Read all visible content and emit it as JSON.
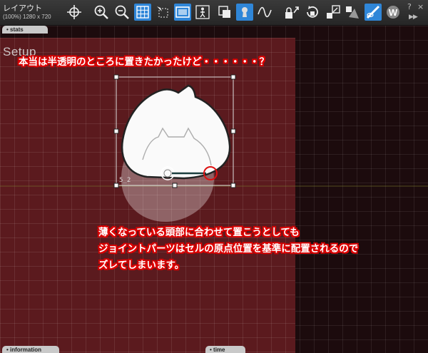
{
  "window": {
    "title": "レイアウト",
    "subtitle": "(100%) 1280 x 720",
    "help": "?",
    "close": "×",
    "expand": "▶▶"
  },
  "toolbar": {
    "active_color": "#2f86d8",
    "icons": [
      {
        "name": "crosshair-icon",
        "active": false
      },
      {
        "name": "zoom-in-icon",
        "active": false
      },
      {
        "name": "zoom-out-icon",
        "active": false
      },
      {
        "name": "grid-icon",
        "active": true
      },
      {
        "name": "select-region-icon",
        "active": false
      },
      {
        "name": "frame-icon",
        "active": true
      },
      {
        "name": "person-icon",
        "active": false
      },
      {
        "name": "layer-stack-icon",
        "active": false
      },
      {
        "name": "keyhole-icon",
        "active": true
      },
      {
        "name": "curve-icon",
        "active": false
      },
      {
        "name": "lock-arrow-icon",
        "active": false
      },
      {
        "name": "rotate-lock-icon",
        "active": false
      },
      {
        "name": "scale-lock-icon",
        "active": false
      },
      {
        "name": "skew-icon",
        "active": false
      },
      {
        "name": "eye-knife-icon",
        "active": true
      },
      {
        "name": "weight-icon",
        "active": false
      }
    ]
  },
  "panels": {
    "stats": "• stats",
    "information": "• information",
    "time": "• time"
  },
  "stage": {
    "label": "Setup",
    "stage_color": "#5b1a1e",
    "outside_color": "#1c0b0d"
  },
  "scene": {
    "bone_label": "5_2"
  },
  "captions": {
    "top": "本当は半透明のところに置きたかったけど・・・・・・？",
    "bottom_lines": [
      "薄くなっている頭部に合わせて置こうとしても",
      "ジョイントパーツはセルの原点位置を基準に配置されるので",
      "ズレてしまいます。"
    ],
    "stroke_color": "#dd0000"
  }
}
